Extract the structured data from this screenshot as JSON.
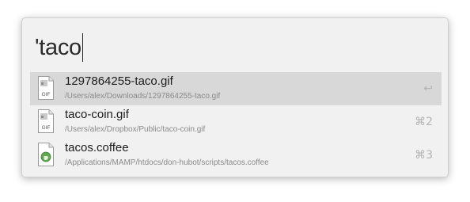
{
  "search": {
    "query": "'taco"
  },
  "results": [
    {
      "title": "1297864255-taco.gif",
      "path": "/Users/alex/Downloads/1297864255-taco.gif",
      "shortcut": "↩",
      "icon": "gif-file-icon",
      "icon_label": "GIF",
      "selected": true
    },
    {
      "title": "taco-coin.gif",
      "path": "/Users/alex/Dropbox/Public/taco-coin.gif",
      "shortcut": "⌘2",
      "icon": "gif-file-icon",
      "icon_label": "GIF",
      "selected": false
    },
    {
      "title": "tacos.coffee",
      "path": "/Applications/MAMP/htdocs/don-hubot/scripts/tacos.coffee",
      "shortcut": "⌘3",
      "icon": "coffee-file-icon",
      "selected": false
    }
  ],
  "colors": {
    "selection": "#d8d8d8",
    "panel": "#f1f1f1",
    "coffee_badge": "#5ea84e"
  }
}
